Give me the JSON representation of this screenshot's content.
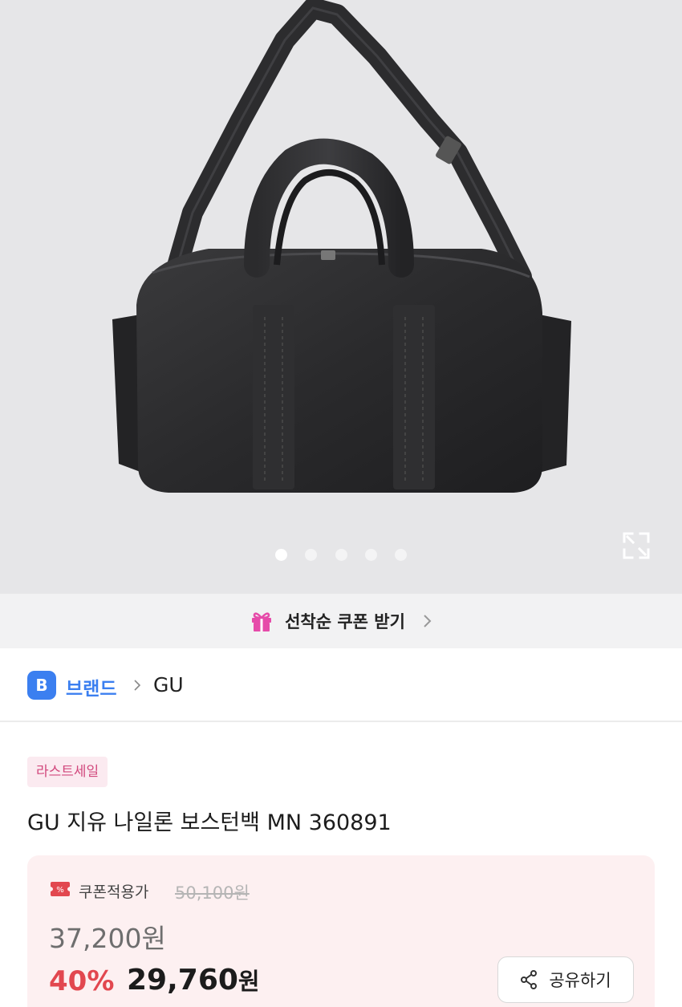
{
  "gallery": {
    "slide_count": 5,
    "active_index": 0
  },
  "coupon_banner": {
    "label": "선착순 쿠폰 받기",
    "icon": "gift-icon",
    "icon_color": "#e64ba9"
  },
  "brand": {
    "badge": "B",
    "label": "브랜드",
    "name": "GU",
    "accent": "#3b7ff0"
  },
  "product": {
    "badge": "라스트세일",
    "title": "GU 지유 나일론 보스턴백 MN 360891"
  },
  "price": {
    "coupon_label": "쿠폰적용가",
    "original": "50,100원",
    "sale_price": "37,200원",
    "discount": "40%",
    "final_amount": "29,760",
    "final_unit": "원",
    "discount_color": "#e2474f"
  },
  "share": {
    "label": "공유하기"
  }
}
